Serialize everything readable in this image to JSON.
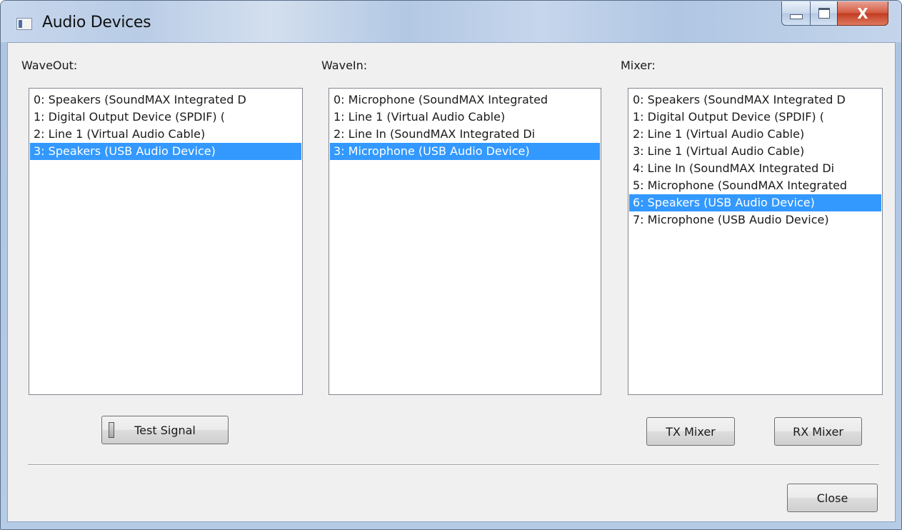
{
  "window": {
    "title": "Audio Devices"
  },
  "caption_buttons": {
    "close_glyph": "X"
  },
  "waveout": {
    "label": "WaveOut:",
    "items": [
      "0: Speakers (SoundMAX Integrated D",
      "1: Digital Output Device (SPDIF) (",
      "2: Line 1 (Virtual Audio Cable)",
      "3: Speakers (USB Audio Device)"
    ],
    "selected_index": 3
  },
  "wavein": {
    "label": "WaveIn:",
    "items": [
      "0: Microphone (SoundMAX Integrated",
      "1: Line 1 (Virtual Audio Cable)",
      "2: Line In (SoundMAX Integrated Di",
      "3: Microphone (USB Audio Device)"
    ],
    "selected_index": 3
  },
  "mixer": {
    "label": "Mixer:",
    "items": [
      "0: Speakers (SoundMAX Integrated D",
      "1: Digital Output Device (SPDIF) (",
      "2: Line 1 (Virtual Audio Cable)",
      "3: Line 1 (Virtual Audio Cable)",
      "4: Line In (SoundMAX Integrated Di",
      "5: Microphone (SoundMAX Integrated",
      "6: Speakers (USB Audio Device)",
      "7: Microphone (USB Audio Device)"
    ],
    "selected_index": 6
  },
  "buttons": {
    "test_signal": "Test Signal",
    "tx_mixer": "TX Mixer",
    "rx_mixer": "RX Mixer",
    "close": "Close"
  },
  "colors": {
    "selection": "#3399ff",
    "dialog_background": "#f0f0f0"
  }
}
